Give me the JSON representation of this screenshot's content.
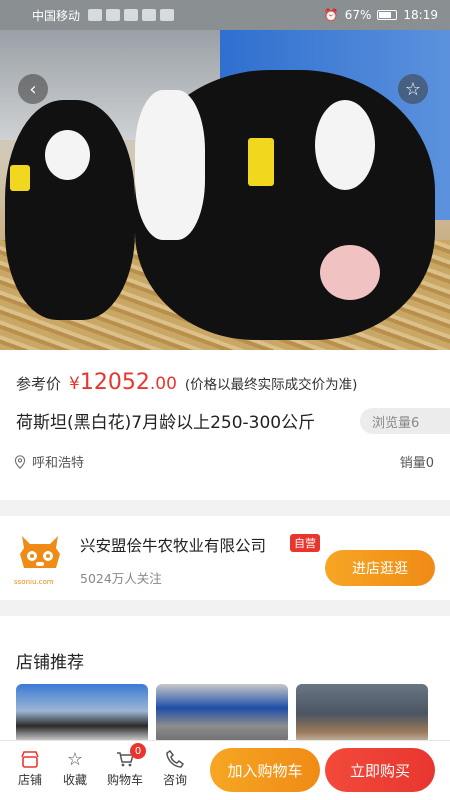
{
  "status_bar": {
    "carrier": "中国移动",
    "battery": "67%",
    "time": "18:19"
  },
  "product": {
    "price_label": "参考价",
    "currency": "¥",
    "price_int": "12052",
    "price_dec": ".00",
    "price_note": "(价格以最终实际成交价为准)",
    "title": "荷斯坦(黑白花)7月龄以上250-300公斤",
    "views": "浏览量6",
    "location": "呼和浩特",
    "sales": "销量0"
  },
  "store": {
    "name": "兴安盟侩牛农牧业有限公司",
    "badge": "自营",
    "followers": "5024万人关注",
    "visit_label": "进店逛逛",
    "logo_text": "ssoniu.com"
  },
  "recommend": {
    "title": "店铺推荐"
  },
  "bottom": {
    "store": "店铺",
    "favorite": "收藏",
    "cart": "购物车",
    "cart_count": "0",
    "consult": "咨询",
    "add_to_cart": "加入购物车",
    "buy_now": "立即购买"
  },
  "colors": {
    "accent_red": "#e8362f",
    "accent_orange": "#f6a623"
  }
}
